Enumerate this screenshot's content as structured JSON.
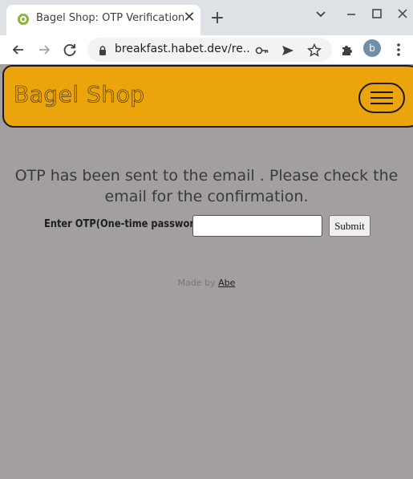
{
  "browser": {
    "tab_title": "Bagel Shop: OTP Verification",
    "url": "breakfast.habet.dev/re...",
    "profile_initial": "b",
    "icons": [
      "favicon",
      "close-icon",
      "plus-icon",
      "chevron-down-icon",
      "minimize-icon",
      "maximize-icon",
      "window-close-icon",
      "back-icon",
      "forward-icon",
      "reload-icon",
      "lock-icon",
      "key-icon",
      "send-icon",
      "star-icon",
      "puzzle-icon",
      "kebab-menu-icon"
    ]
  },
  "navbar": {
    "brand": "Bagel Shop",
    "menu_icon": "hamburger-icon",
    "color": "#eca40c"
  },
  "main": {
    "message": "OTP has been sent to the email . Please check the email for the confirmation.",
    "otp_label": "Enter OTP(One-time password):",
    "otp_value": "",
    "submit_label": "Submit"
  },
  "footer": {
    "made_by": "Made by",
    "author": "Abe"
  },
  "colors": {
    "page_bg": "#a39fa0",
    "accent": "#eca40c"
  }
}
